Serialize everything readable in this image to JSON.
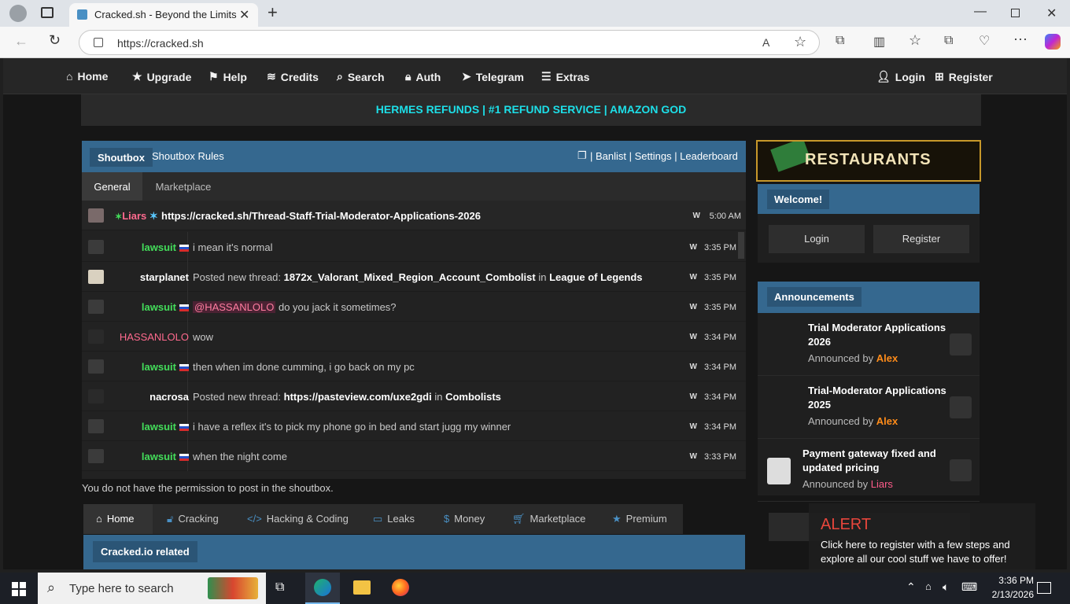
{
  "browser": {
    "tab_title": "Cracked.sh - Beyond the Limits",
    "url": "https://cracked.sh"
  },
  "nav": {
    "items": [
      "Home",
      "Upgrade",
      "Help",
      "Credits",
      "Search",
      "Auth",
      "Telegram",
      "Extras"
    ],
    "login": "Login",
    "register": "Register"
  },
  "promo": "HERMES REFUNDS | #1 REFUND SERVICE | AMAZON GOD",
  "shoutbox": {
    "title": "Shoutbox",
    "rules": "Shoutbox Rules",
    "right_links": "| Banlist | Settings | Leaderboard",
    "tabs": [
      "General",
      "Marketplace"
    ],
    "pinned": {
      "user": "Liars",
      "message": "https://cracked.sh/Thread-Staff-Trial-Moderator-Applications-2026",
      "w": "W",
      "time": "5:00 AM"
    },
    "rows": [
      {
        "user": "lawsuit",
        "message": "i mean it's normal",
        "w": "W",
        "time": "3:35 PM"
      },
      {
        "user": "starplanet",
        "prefix": "Posted new thread:",
        "thread": "1872x_Valorant_Mixed_Region_Account_Combolist",
        "in": "in",
        "forum": "League of Legends",
        "w": "W",
        "time": "3:35 PM"
      },
      {
        "user": "lawsuit",
        "mention": "@HASSANLOLO",
        "message": "do you jack it sometimes?",
        "w": "W",
        "time": "3:35 PM"
      },
      {
        "user": "HASSANLOLO",
        "message": "wow",
        "w": "W",
        "time": "3:34 PM"
      },
      {
        "user": "lawsuit",
        "message": "then when im done cumming, i go back on my pc",
        "w": "W",
        "time": "3:34 PM"
      },
      {
        "user": "nacrosa",
        "prefix": "Posted new thread:",
        "thread": "https://pasteview.com/uxe2gdi",
        "in": "in",
        "forum": "Combolists",
        "w": "W",
        "time": "3:34 PM"
      },
      {
        "user": "lawsuit",
        "message": "i have a reflex it's to pick my phone go in bed and start jugg my winner",
        "w": "W",
        "time": "3:34 PM"
      },
      {
        "user": "lawsuit",
        "message": "when the night come",
        "w": "W",
        "time": "3:33 PM"
      }
    ],
    "no_permission": "You do not have the permission to post in the shoutbox."
  },
  "forum_tabs": [
    "Home",
    "Cracking",
    "Hacking & Coding",
    "Leaks",
    "Money",
    "Marketplace",
    "Premium"
  ],
  "category": "Cracked.io related",
  "sidebar": {
    "banner": "RESTAURANTS",
    "welcome": "Welcome!",
    "login": "Login",
    "register": "Register",
    "announcements_title": "Announcements",
    "announcements": [
      {
        "title": "Trial Moderator Applications 2026",
        "by": "Announced by",
        "author": "Alex"
      },
      {
        "title": "Trial-Moderator Applications 2025",
        "by": "Announced by",
        "author": "Alex"
      },
      {
        "title": "Payment gateway fixed and updated pricing",
        "by": "Announced by",
        "author": "Liars"
      }
    ]
  },
  "alert": {
    "title": "ALERT",
    "text": "Click here to register with a few steps and explore all our cool stuff we have to offer!"
  },
  "taskbar": {
    "search_placeholder": "Type here to search",
    "time": "3:36 PM",
    "date": "2/13/2026"
  },
  "colors": {
    "accent_blue": "#35688f",
    "promo_cyan": "#1ddfe8",
    "alert_red": "#e8463c"
  }
}
